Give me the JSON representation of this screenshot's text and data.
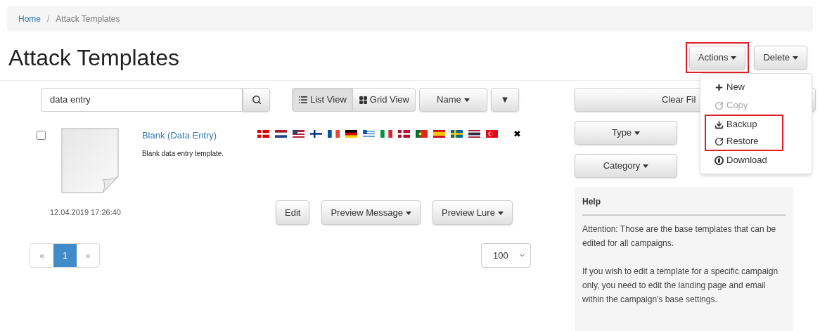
{
  "breadcrumb": [
    {
      "label": "Home",
      "link": true
    },
    {
      "label": "Attack Templates",
      "link": false
    }
  ],
  "breadcrumb_separator": "/",
  "title": "Attack Templates",
  "header_buttons": [
    {
      "label": "Actions",
      "highlighted": true
    },
    {
      "label": "Delete",
      "highlighted": false
    }
  ],
  "actions_menu": [
    {
      "label": "New",
      "kind": "plus",
      "disabled": false,
      "highlighted": false
    },
    {
      "label": "Copy",
      "kind": "refresh",
      "disabled": true,
      "highlighted": false
    },
    {
      "label": "Backup",
      "kind": "download",
      "disabled": false,
      "highlighted": true
    },
    {
      "label": "Restore",
      "kind": "refresh",
      "disabled": false,
      "highlighted": true
    },
    {
      "label": "Download",
      "kind": "circle",
      "disabled": false,
      "highlighted": false
    }
  ],
  "search": {
    "value": "data entry"
  },
  "view_toggle": [
    {
      "label": "List View",
      "kind": "list",
      "selected": true
    },
    {
      "label": "Grid View",
      "kind": "grid",
      "selected": false
    }
  ],
  "sort": {
    "label": "Name",
    "direction_symbol": "▼"
  },
  "filters": {
    "clear": "Clear Fil",
    "type": "Type",
    "category": "Category"
  },
  "templates": [
    {
      "checked": false,
      "name": "Blank (Data Entry)",
      "description": "Blank data entry template.",
      "date": "12.04.2019 17:26:40",
      "remove_symbol": "✖",
      "buttons": [
        {
          "label": "Edit",
          "dropdown": false
        },
        {
          "label": "Preview Message",
          "dropdown": true
        },
        {
          "label": "Preview Lure",
          "dropdown": true
        }
      ]
    }
  ],
  "pagination": {
    "prev": "«",
    "pages": [
      {
        "label": "1",
        "selected": true
      }
    ],
    "next": "»"
  },
  "page_size": "100",
  "help": {
    "title": "Help",
    "paragraphs": [
      "Attention: Those are the base templates that can be edited for all campaigns.",
      "If you wish to edit a template for a specific campaign only, you need to edit the landing page and email within the campaign's base settings."
    ]
  }
}
